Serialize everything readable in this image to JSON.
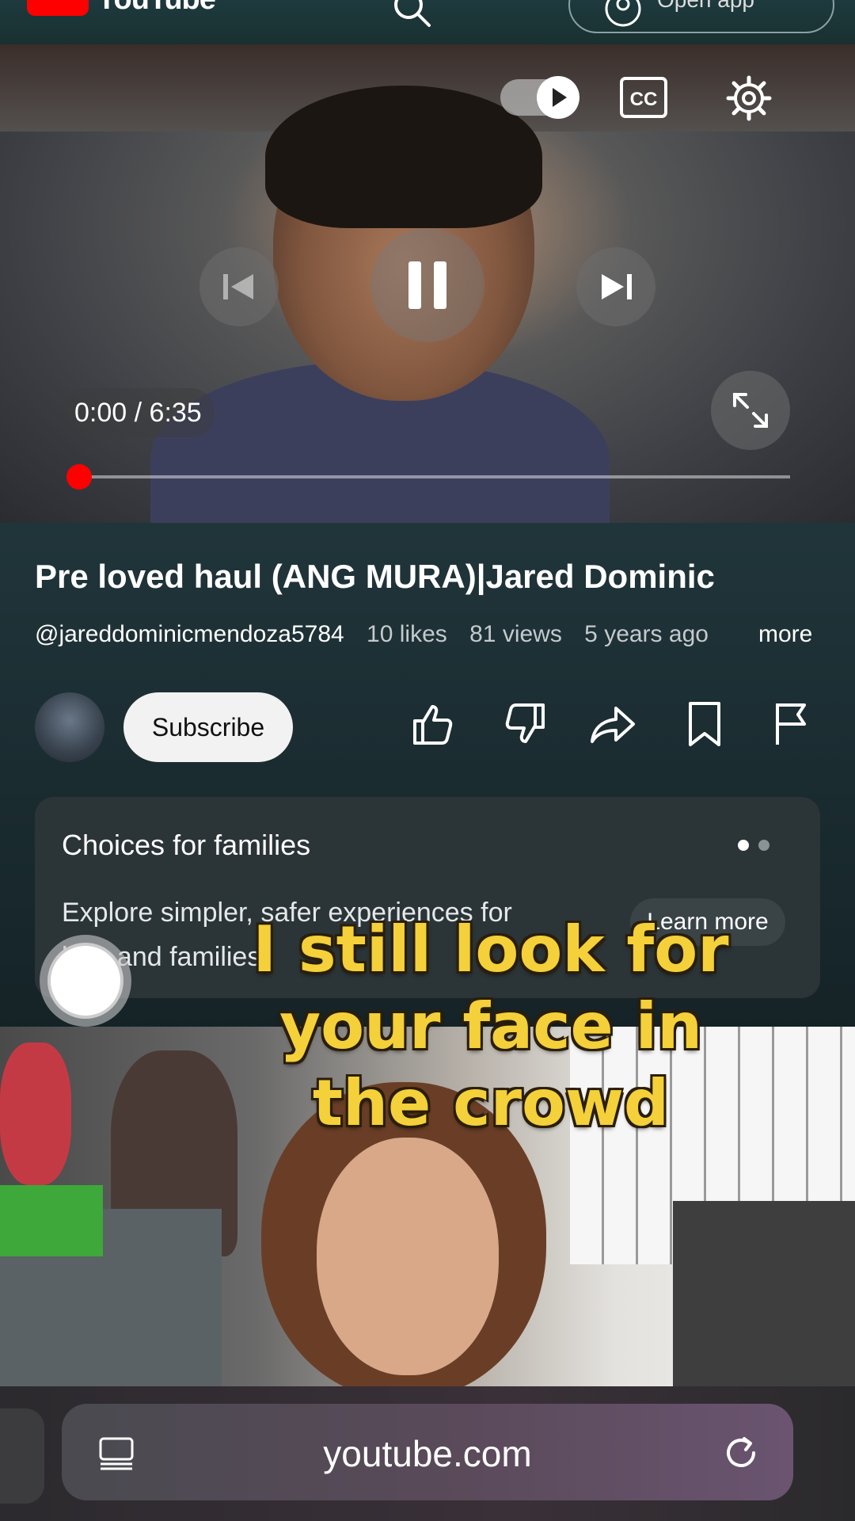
{
  "app": {
    "logo_text": "YouTube",
    "open_app_label": "Open app"
  },
  "player": {
    "current_time": "0:00",
    "separator": "/",
    "duration": "6:35",
    "progress_fraction": 0.0,
    "autoplay_on": true
  },
  "video": {
    "title": "Pre loved haul (ANG MURA)|Jared Dominic",
    "channel_handle": "@jareddominicmendoza5784",
    "likes": "10 likes",
    "views": "81 views",
    "age": "5 years ago",
    "more_label": "more",
    "subscribe_label": "Subscribe"
  },
  "card": {
    "title": "Choices for families",
    "body": "Explore simpler, safer experiences for kids and families",
    "button": "Learn more"
  },
  "overlay": {
    "lyric": "I still look for your face in the crowd"
  },
  "browser": {
    "url": "youtube.com"
  },
  "colors": {
    "accent": "#ff0000",
    "lyric": "#f4d03a"
  }
}
